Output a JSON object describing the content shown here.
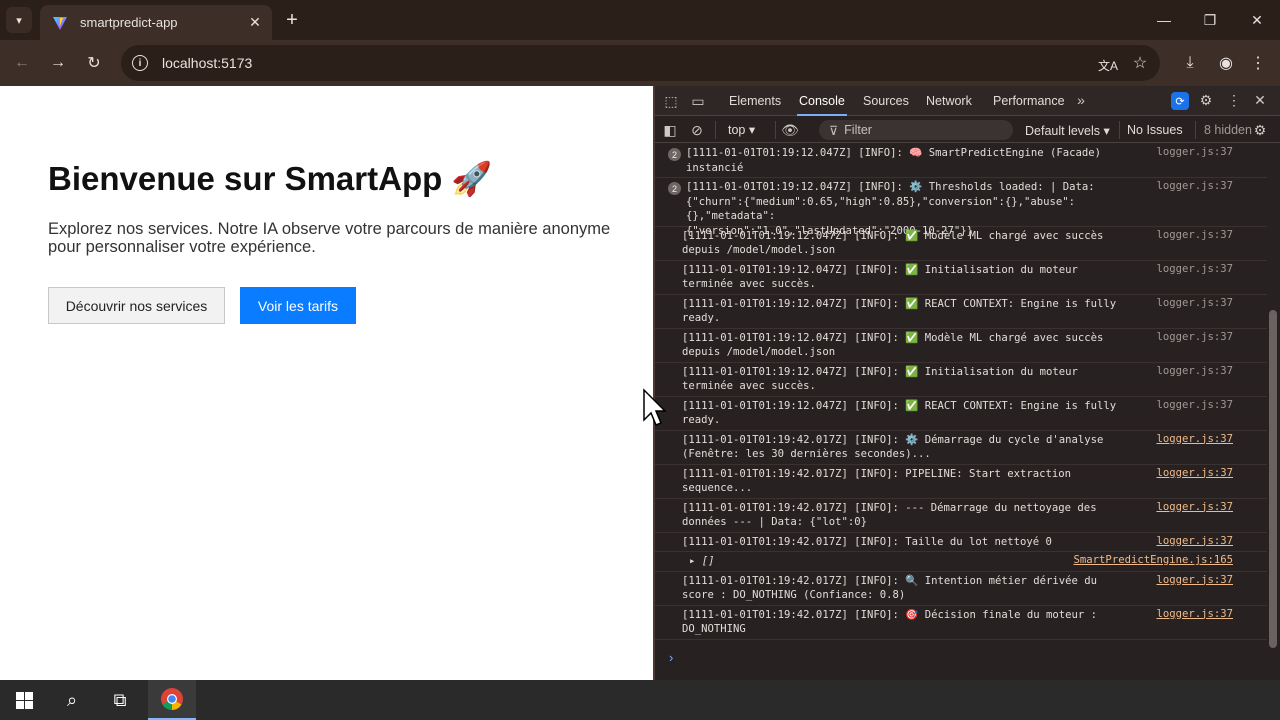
{
  "browser": {
    "tab_title": "smartpredict-app",
    "url": "localhost:5173"
  },
  "page": {
    "heading": "Bienvenue sur SmartApp 🚀",
    "paragraph": "Explorez nos services. Notre IA observe votre parcours de manière anonyme pour personnaliser votre expérience.",
    "btn_secondary": "Découvrir nos services",
    "btn_primary": "Voir les tarifs"
  },
  "devtools": {
    "tabs": [
      "Elements",
      "Console",
      "Sources",
      "Network",
      "Performance"
    ],
    "context": "top",
    "filter_placeholder": "Filter",
    "levels": "Default levels",
    "issues": "No Issues",
    "hidden": "8 hidden",
    "logs": [
      {
        "count": "2",
        "msg": "[1111-01-01T01:19:12.047Z] [INFO]: 🧠 SmartPredictEngine (Facade)\ninstancié",
        "src": "logger.js:37",
        "link": false
      },
      {
        "count": "2",
        "msg": "[1111-01-01T01:19:12.047Z] [INFO]: ⚙️ Thresholds loaded: | Data:\n{\"churn\":{\"medium\":0.65,\"high\":0.85},\"conversion\":{},\"abuse\":{},\"metadata\":\n{\"version\":\"1.0\",\"lastUpdated\":\"2000-10-27\"}}",
        "src": "logger.js:37",
        "link": false
      },
      {
        "count": "",
        "msg": "[1111-01-01T01:19:12.047Z] [INFO]: ✅ Modèle ML chargé avec succès\ndepuis /model/model.json",
        "src": "logger.js:37",
        "link": false
      },
      {
        "count": "",
        "msg": "[1111-01-01T01:19:12.047Z] [INFO]: ✅ Initialisation du moteur\nterminée avec succès.",
        "src": "logger.js:37",
        "link": false
      },
      {
        "count": "",
        "msg": "[1111-01-01T01:19:12.047Z] [INFO]: ✅ REACT CONTEXT: Engine is fully\nready.",
        "src": "logger.js:37",
        "link": false
      },
      {
        "count": "",
        "msg": "[1111-01-01T01:19:12.047Z] [INFO]: ✅ Modèle ML chargé avec succès\ndepuis /model/model.json",
        "src": "logger.js:37",
        "link": false
      },
      {
        "count": "",
        "msg": "[1111-01-01T01:19:12.047Z] [INFO]: ✅ Initialisation du moteur\nterminée avec succès.",
        "src": "logger.js:37",
        "link": false
      },
      {
        "count": "",
        "msg": "[1111-01-01T01:19:12.047Z] [INFO]: ✅ REACT CONTEXT: Engine is fully\nready.",
        "src": "logger.js:37",
        "link": false
      },
      {
        "count": "",
        "msg": "[1111-01-01T01:19:42.017Z] [INFO]: ⚙️ Démarrage du cycle d'analyse\n(Fenêtre: les 30 dernières secondes)...",
        "src": "logger.js:37",
        "link": true
      },
      {
        "count": "",
        "msg": "[1111-01-01T01:19:42.017Z] [INFO]: PIPELINE: Start extraction\nsequence...",
        "src": "logger.js:37",
        "link": true
      },
      {
        "count": "",
        "msg": "[1111-01-01T01:19:42.017Z] [INFO]: --- Démarrage du nettoyage des\ndonnées --- | Data: {\"lot\":0}",
        "src": "logger.js:37",
        "link": true
      },
      {
        "count": "",
        "msg": "[1111-01-01T01:19:42.017Z] [INFO]: Taille du lot nettoyé 0",
        "src": "logger.js:37",
        "link": true
      },
      {
        "count": "",
        "msg": "▸ []",
        "src": "SmartPredictEngine.js:165",
        "link": true
      },
      {
        "count": "",
        "msg": "[1111-01-01T01:19:42.017Z] [INFO]: 🔍 Intention métier dérivée du\nscore : DO_NOTHING (Confiance: 0.8)",
        "src": "logger.js:37",
        "link": true
      },
      {
        "count": "",
        "msg": "[1111-01-01T01:19:42.017Z] [INFO]: 🎯 Décision finale du moteur :\nDO_NOTHING",
        "src": "logger.js:37",
        "link": true
      }
    ],
    "prompt": "›"
  }
}
